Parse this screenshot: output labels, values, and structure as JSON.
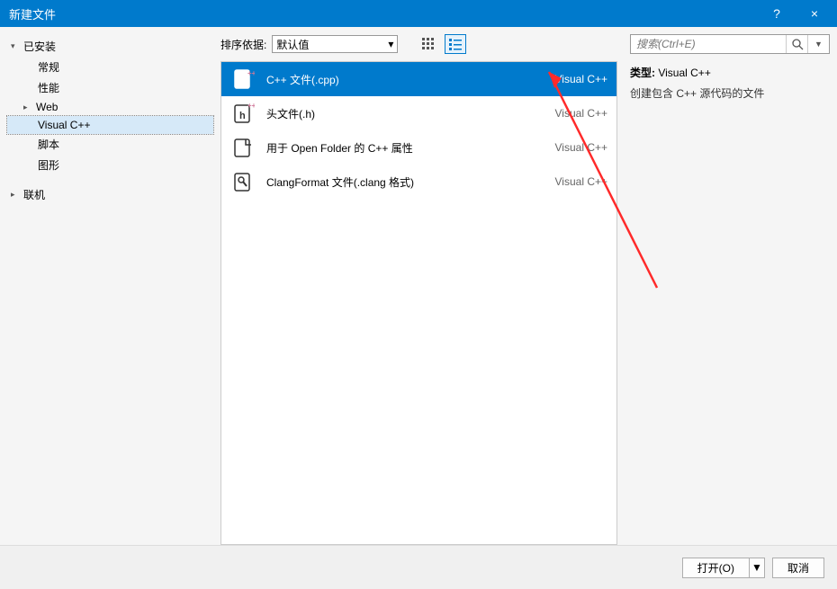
{
  "titlebar": {
    "title": "新建文件",
    "help": "?",
    "close": "×"
  },
  "sidebar": {
    "installed": "已安装",
    "items": [
      {
        "label": "常规"
      },
      {
        "label": "性能"
      },
      {
        "label": "Web",
        "expandable": true
      },
      {
        "label": "Visual C++",
        "selected": true
      },
      {
        "label": "脚本"
      },
      {
        "label": "图形"
      }
    ],
    "online": "联机"
  },
  "toolbar": {
    "sort_label": "排序依据:",
    "sort_value": "默认值"
  },
  "templates": [
    {
      "name": "C++ 文件(.cpp)",
      "category": "Visual C++",
      "selected": true,
      "icon": "cpp"
    },
    {
      "name": "头文件(.h)",
      "category": "Visual C++",
      "icon": "h"
    },
    {
      "name": "用于 Open Folder 的 C++ 属性",
      "category": "Visual C++",
      "icon": "folder"
    },
    {
      "name": "ClangFormat 文件(.clang 格式)",
      "category": "Visual C++",
      "icon": "wrench"
    }
  ],
  "search": {
    "placeholder": "搜索(Ctrl+E)"
  },
  "detail": {
    "type_label": "类型:",
    "type_value": "Visual C++",
    "description": "创建包含 C++ 源代码的文件"
  },
  "footer": {
    "open": "打开(O)",
    "cancel": "取消"
  }
}
